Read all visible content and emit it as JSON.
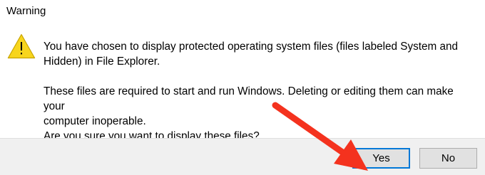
{
  "dialog": {
    "title": "Warning",
    "icon": "warning-icon",
    "message": {
      "paragraph1_line1": "You have chosen to display protected operating system files (files labeled System and",
      "paragraph1_line2": "Hidden) in File Explorer.",
      "paragraph2_line1": "These files are required to start and run Windows. Deleting or editing them can make your",
      "paragraph2_line2": "computer inoperable.",
      "question": "Are you sure you want to display these files?"
    },
    "buttons": {
      "yes_label": "Yes",
      "no_label": "No"
    }
  },
  "annotation": {
    "arrow_color": "#f4321e",
    "points_to": "yes-button"
  },
  "colors": {
    "footer_bg": "#f0f0f0",
    "button_bg": "#e1e1e1",
    "focus_border": "#0078d7",
    "warning_yellow": "#f7d51d"
  }
}
